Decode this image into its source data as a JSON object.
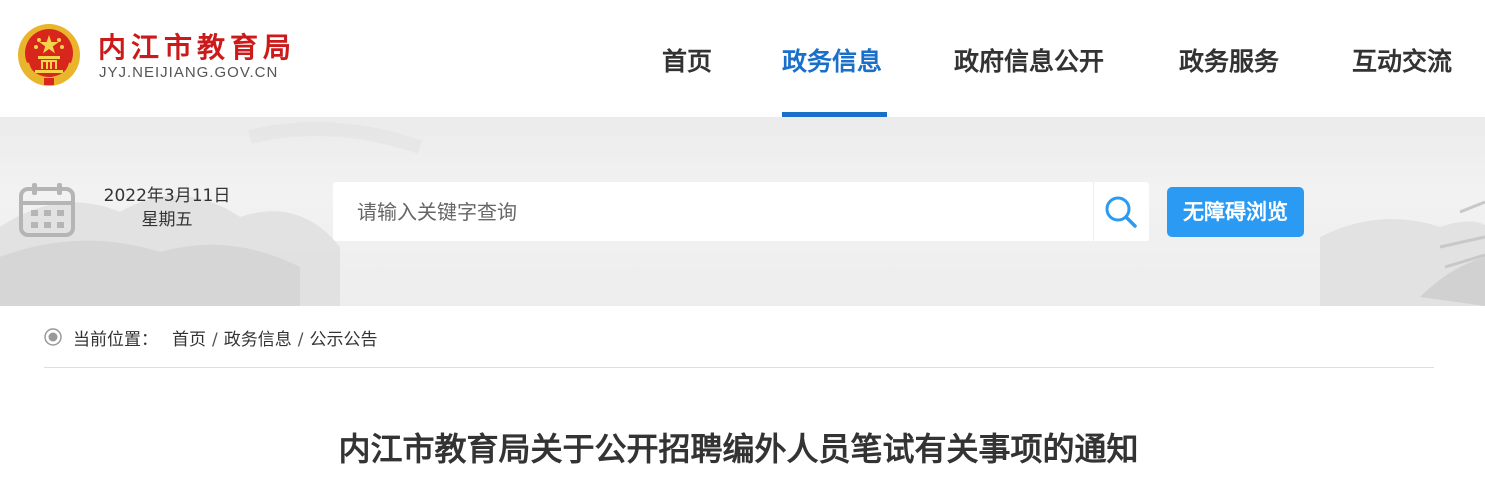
{
  "header": {
    "site_title": "内江市教育局",
    "site_domain": "JYJ.NEIJIANG.GOV.CN"
  },
  "nav": {
    "items": [
      {
        "label": "首页",
        "active": false
      },
      {
        "label": "政务信息",
        "active": true
      },
      {
        "label": "政府信息公开",
        "active": false
      },
      {
        "label": "政务服务",
        "active": false
      },
      {
        "label": "互动交流",
        "active": false
      }
    ]
  },
  "banner": {
    "date": "2022年3月11日",
    "weekday": "星期五",
    "search_placeholder": "请输入关键字查询",
    "accessible_label": "无障碍浏览"
  },
  "breadcrumb": {
    "label": "当前位置：",
    "items": [
      "首页",
      "政务信息",
      "公示公告"
    ],
    "separator": "/"
  },
  "article": {
    "title": "内江市教育局关于公开招聘编外人员笔试有关事项的通知"
  },
  "colors": {
    "brand_red": "#cc1a1a",
    "nav_active": "#1a6fc9",
    "accessible_button": "#2b9af3"
  },
  "icons": {
    "logo": "national-emblem",
    "calendar": "calendar-icon",
    "search": "search-icon",
    "breadcrumb": "radio-dot-icon"
  }
}
